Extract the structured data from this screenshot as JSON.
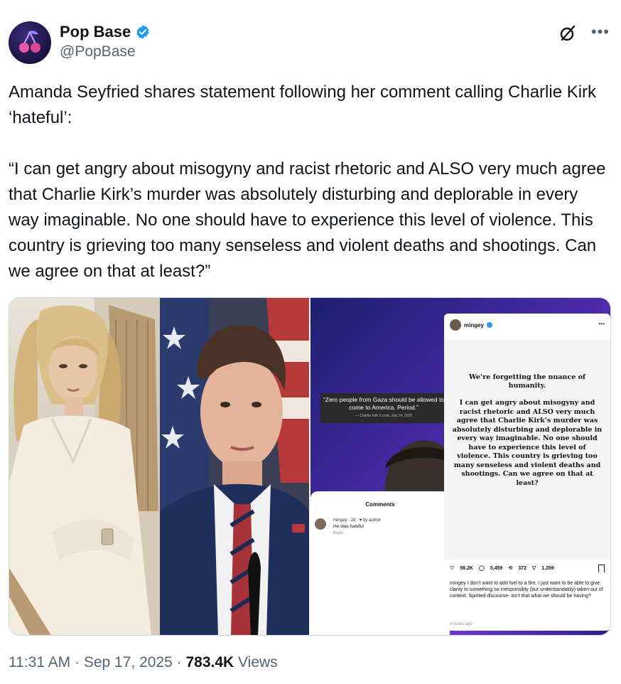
{
  "author": {
    "display_name": "Pop Base",
    "handle": "@PopBase",
    "verified_color": "#1d9bf0"
  },
  "tweet": {
    "text": "Amanda Seyfried shares statement following her comment calling Charlie Kirk ‘hateful’:\n\n“I can get angry about misogyny and racist rhetoric and ALSO very much agree that Charlie Kirk’s murder was absolutely disturbing and deplorable in every way imaginable. No one should have to experience this level of violence. This country is grieving too many senseless and violent deaths and shootings. Can we agree on that at least?”"
  },
  "media": {
    "quote_card": {
      "text": "“Zero people from Gaza should be allowed to come to America. Period.”",
      "source": "— Charlie Kirk X post, July 14, 2025"
    },
    "comments": {
      "title": "Comments",
      "user": "mingey · 2d · ♥ by author",
      "text": "He was hateful",
      "reply": "Reply"
    },
    "instagram": {
      "username": "mingey",
      "headline": "We’re forgetting the nuance of humanity.",
      "body": "I can get angry about misogyny and racist rhetoric and ALSO very much agree that Charlie Kirk’s murder was absolutely disturbing and deplorable in every way imaginable. No one should have to experience this level of violence. This country is grieving too many senseless and violent deaths and shootings. Can we agree on that at least?",
      "likes": "56.2K",
      "comments": "5,459",
      "reposts": "372",
      "shares": "1,359",
      "caption": "mingey I don’t want to add fuel to a fire. I just want to be able to give clarity to something so irresponsibly (but understandably) taken out of context. Spirited discourse- isn’t that what we should be having?",
      "time": "4 hours ago"
    }
  },
  "meta": {
    "time": "11:31 AM",
    "date": "Sep 17, 2025",
    "views_count": "783.4K",
    "views_label": "Views"
  }
}
